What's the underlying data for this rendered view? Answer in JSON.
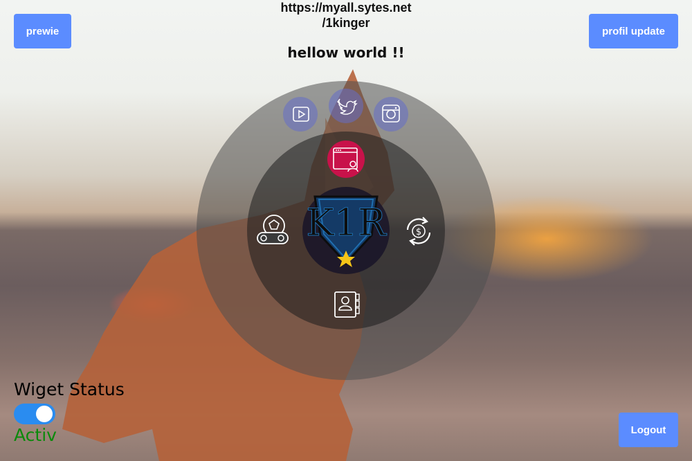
{
  "header": {
    "url": "https://myall.sytes.net\n/1kinger",
    "url_line1": "https://myall.sytes.net",
    "url_line2": "/1kinger",
    "greeting": "hellow world !!"
  },
  "buttons": {
    "preview_label": "prewie",
    "profile_update_label": "profil update",
    "logout_label": "Logout"
  },
  "menu": {
    "social": [
      "youtube-icon",
      "twitter-icon",
      "instagram-icon"
    ],
    "center_logo": "k1r-shield-logo",
    "items": [
      "user-app-icon",
      "games-icon",
      "currency-exchange-icon",
      "contacts-icon"
    ]
  },
  "widget": {
    "title": "Wiget Status",
    "toggle_on": true,
    "status_text": "Activ"
  },
  "colors": {
    "button": "#5b8cff",
    "toggle": "#2a8cf0",
    "status_text": "#0a8a0a",
    "user_app_bg": "#c8124a"
  }
}
